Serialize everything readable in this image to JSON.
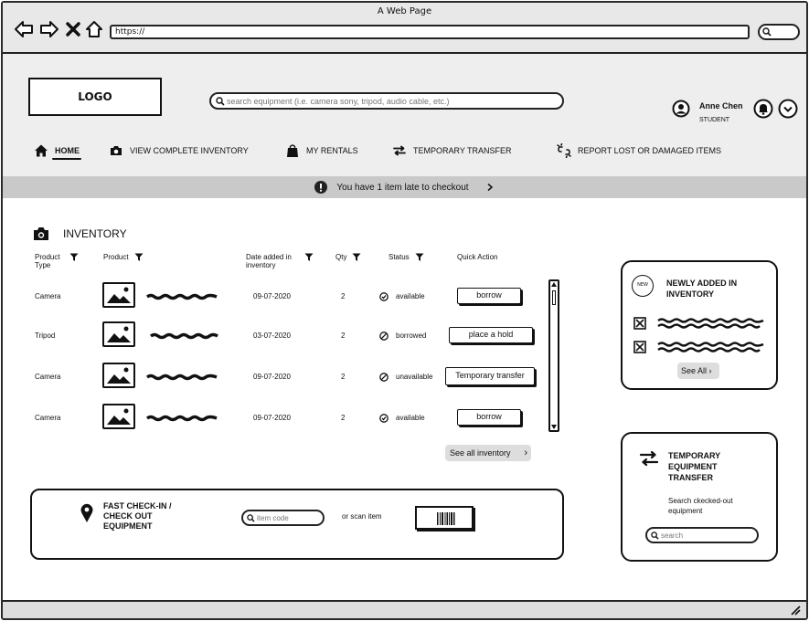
{
  "browser": {
    "title": "A Web Page",
    "url": "https://"
  },
  "header": {
    "logo": "LOGO",
    "search_placeholder": "search equipment (i.e. camera sony, tripod, audio cable, etc.)",
    "user_name": "Anne Chen",
    "user_role": "STUDENT"
  },
  "nav": {
    "items": [
      {
        "label": "HOME",
        "icon": "home-icon",
        "active": true
      },
      {
        "label": "VIEW COMPLETE INVENTORY",
        "icon": "camera-icon"
      },
      {
        "label": "MY RENTALS",
        "icon": "bag-icon"
      },
      {
        "label": "TEMPORARY TRANSFER",
        "icon": "transfer-icon"
      },
      {
        "label": "REPORT LOST OR DAMAGED ITEMS",
        "icon": "broken-link-icon"
      }
    ]
  },
  "alert": {
    "text": "You have 1 item late to checkout"
  },
  "inventory": {
    "title": "INVENTORY",
    "columns": [
      "Product Type",
      "Product",
      "Date added in inventory",
      "Qty",
      "Status",
      "Quick Action"
    ],
    "rows": [
      {
        "type": "Camera",
        "date": "09-07-2020",
        "qty": "2",
        "status": "available",
        "status_icon": "check-circle-icon",
        "action": "borrow"
      },
      {
        "type": "Tripod",
        "date": "03-07-2020",
        "qty": "2",
        "status": "borrowed",
        "status_icon": "no-entry-icon",
        "action": "place a hold"
      },
      {
        "type": "Camera",
        "date": "09-07-2020",
        "qty": "2",
        "status": "unavailable",
        "status_icon": "no-entry-icon",
        "action": "Temporary transfer"
      },
      {
        "type": "Camera",
        "date": "09-07-2020",
        "qty": "2",
        "status": "available",
        "status_icon": "check-circle-icon",
        "action": "borrow"
      }
    ],
    "see_all": "See all inventory"
  },
  "checkin": {
    "title": "FAST CHECK-IN / CHECK OUT EQUIPMENT",
    "item_code_placeholder": "item code",
    "scan_label": "or scan item"
  },
  "new_added": {
    "badge": "NEW",
    "title": "NEWLY ADDED IN INVENTORY",
    "see_all": "See All"
  },
  "transfer": {
    "title": "TEMPORARY EQUIPMENT TRANSFER",
    "subtitle": "Search ckecked-out equipment",
    "search_placeholder": "search"
  }
}
